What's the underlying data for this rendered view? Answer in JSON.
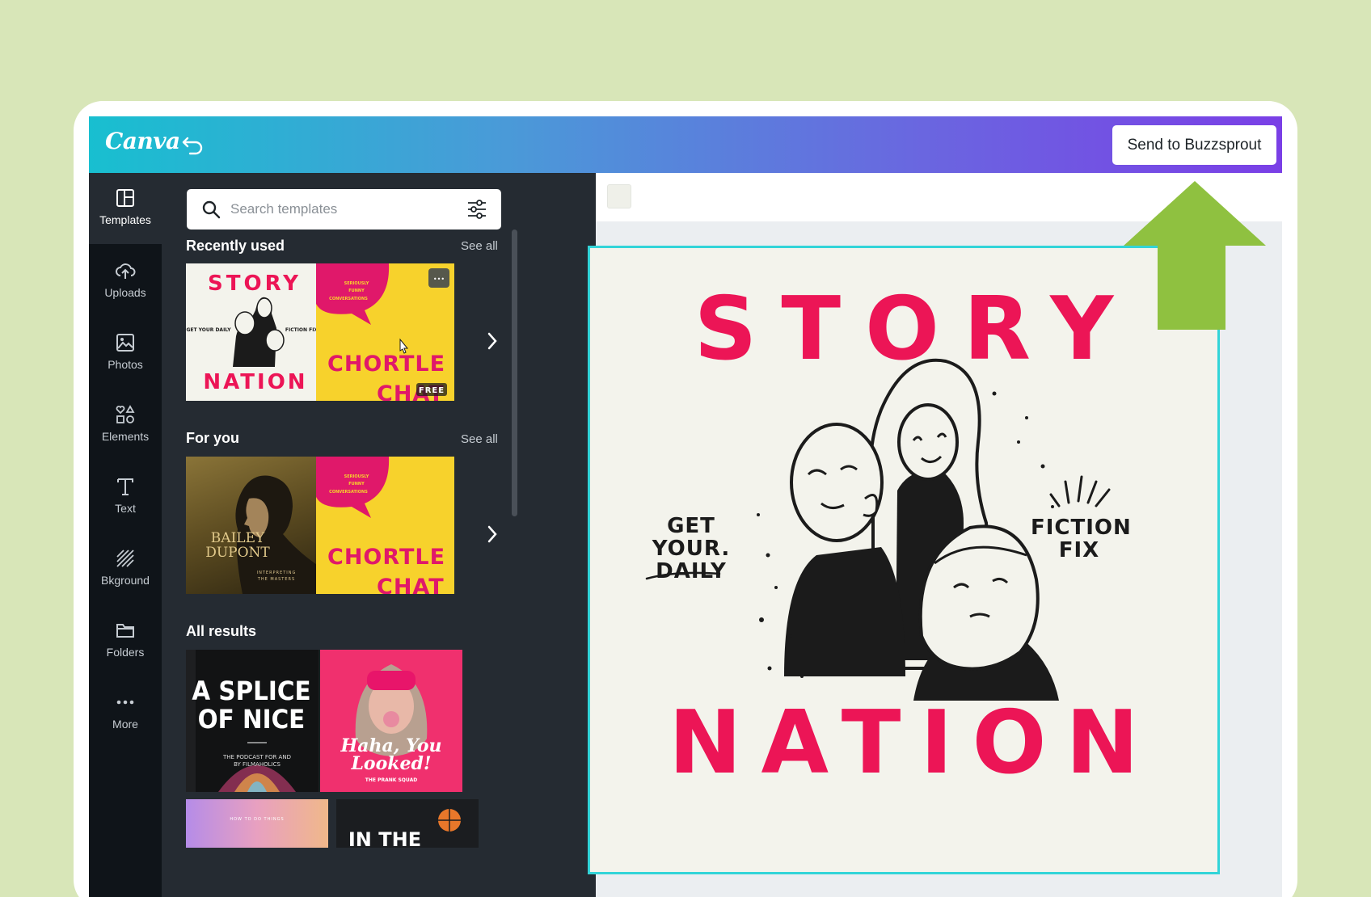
{
  "app": {
    "logo": "Canva",
    "undo_icon": "undo-icon"
  },
  "header": {
    "send_button": "Send to Buzzsprout"
  },
  "rail": [
    {
      "label": "Templates",
      "icon": "templates-icon"
    },
    {
      "label": "Uploads",
      "icon": "upload-cloud-icon"
    },
    {
      "label": "Photos",
      "icon": "photo-icon"
    },
    {
      "label": "Elements",
      "icon": "shapes-icon"
    },
    {
      "label": "Text",
      "icon": "text-icon"
    },
    {
      "label": "Bkground",
      "icon": "background-icon"
    },
    {
      "label": "Folders",
      "icon": "folder-icon"
    },
    {
      "label": "More",
      "icon": "more-icon"
    }
  ],
  "search": {
    "placeholder": "Search templates"
  },
  "sections": {
    "recent": {
      "title": "Recently used",
      "see_all": "See all"
    },
    "for_you": {
      "title": "For you",
      "see_all": "See all"
    },
    "all": {
      "title": "All results"
    }
  },
  "thumbs": {
    "story_top": "STORY",
    "story_bottom": "NATION",
    "story_left": "GET YOUR DAILY",
    "story_right": "FICTION FIX",
    "chortle_line1": "SERIOUSLY",
    "chortle_line2": "FUNNY",
    "chortle_line3": "CONVERSATIONS",
    "chortle_title1": "CHORTLE",
    "chortle_title2": "CHAT",
    "free_badge": "FREE",
    "more_dots": "•••",
    "bailey_title1": "BAILEY",
    "bailey_title2": "DUPONT",
    "bailey_sub1": "INTERPRETING",
    "bailey_sub2": "THE MASTERS",
    "splice_line1": "A SPLICE",
    "splice_line2": "OF NICE",
    "splice_sub1": "THE PODCAST FOR AND",
    "splice_sub2": "BY FILMAHOLICS",
    "haha_line1": "Haha, You",
    "haha_line2": "Looked!",
    "haha_sub": "THE PRANK SQUAD",
    "peek_left": "HOW TO DO THINGS",
    "peek_right": "IN THE"
  },
  "design": {
    "title_top": "STORY",
    "title_bottom": "NATION",
    "left_text_1": "GET YOUR.",
    "left_text_2": "DAILY",
    "right_text_1": "FICTION",
    "right_text_2": "FIX"
  },
  "colors": {
    "accent_pink": "#ec1556",
    "arrow_green": "#8fc140",
    "selection": "#32d4d8",
    "page_bg": "#d8e6b8"
  }
}
